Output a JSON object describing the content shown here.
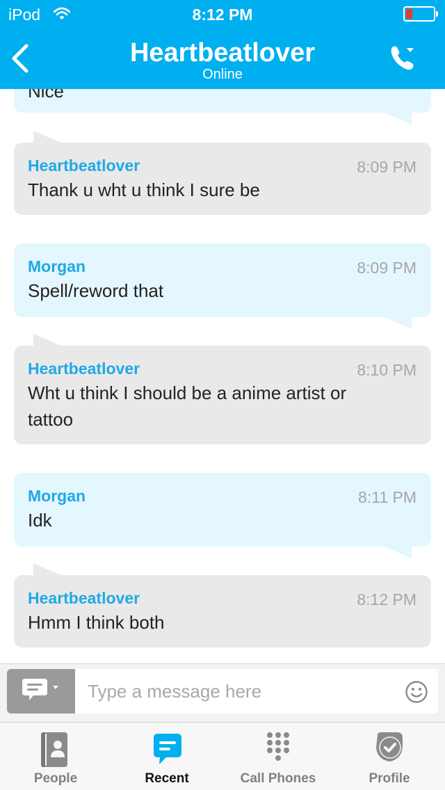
{
  "status_bar": {
    "carrier": "iPod",
    "time": "8:12 PM",
    "battery_color": "#e8392f"
  },
  "header": {
    "title": "Heartbeatlover",
    "status": "Online",
    "accent_color": "#00aff0"
  },
  "messages": [
    {
      "direction": "outgoing",
      "sender": "",
      "time": "",
      "text": "Nice"
    },
    {
      "direction": "incoming",
      "sender": "Heartbeatlover",
      "time": "8:09 PM",
      "text": "Thank u wht u think I sure be"
    },
    {
      "direction": "outgoing",
      "sender": "Morgan",
      "time": "8:09 PM",
      "text": "Spell/reword that"
    },
    {
      "direction": "incoming",
      "sender": "Heartbeatlover",
      "time": "8:10 PM",
      "text": "Wht u think I should be a anime artist or tattoo"
    },
    {
      "direction": "outgoing",
      "sender": "Morgan",
      "time": "8:11 PM",
      "text": "Idk"
    },
    {
      "direction": "incoming",
      "sender": "Heartbeatlover",
      "time": "8:12 PM",
      "text": "Hmm I think both"
    }
  ],
  "composer": {
    "placeholder": "Type a message here",
    "mode_icon": "chat-bubble-icon",
    "emoji_icon": "smiley-icon"
  },
  "tabs": [
    {
      "label": "People",
      "icon": "contacts-book-icon",
      "active": false
    },
    {
      "label": "Recent",
      "icon": "chat-bubble-icon",
      "active": true
    },
    {
      "label": "Call Phones",
      "icon": "dialpad-icon",
      "active": false
    },
    {
      "label": "Profile",
      "icon": "presence-check-icon",
      "active": false
    }
  ]
}
